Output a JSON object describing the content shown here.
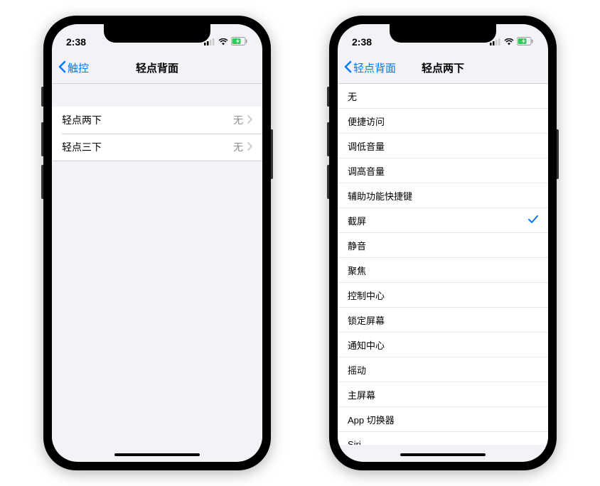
{
  "status_bar": {
    "time": "2:38"
  },
  "left_phone": {
    "nav": {
      "back_label": "触控",
      "title": "轻点背面"
    },
    "rows": [
      {
        "label": "轻点两下",
        "value": "无"
      },
      {
        "label": "轻点三下",
        "value": "无"
      }
    ]
  },
  "right_phone": {
    "nav": {
      "back_label": "轻点背面",
      "title": "轻点两下"
    },
    "options": [
      {
        "label": "无",
        "selected": false
      },
      {
        "label": "便捷访问",
        "selected": false
      },
      {
        "label": "调低音量",
        "selected": false
      },
      {
        "label": "调高音量",
        "selected": false
      },
      {
        "label": "辅助功能快捷键",
        "selected": false
      },
      {
        "label": "截屏",
        "selected": true
      },
      {
        "label": "静音",
        "selected": false
      },
      {
        "label": "聚焦",
        "selected": false
      },
      {
        "label": "控制中心",
        "selected": false
      },
      {
        "label": "锁定屏幕",
        "selected": false
      },
      {
        "label": "通知中心",
        "selected": false
      },
      {
        "label": "摇动",
        "selected": false
      },
      {
        "label": "主屏幕",
        "selected": false
      },
      {
        "label": "App 切换器",
        "selected": false
      },
      {
        "label": "Siri",
        "selected": false
      }
    ]
  }
}
